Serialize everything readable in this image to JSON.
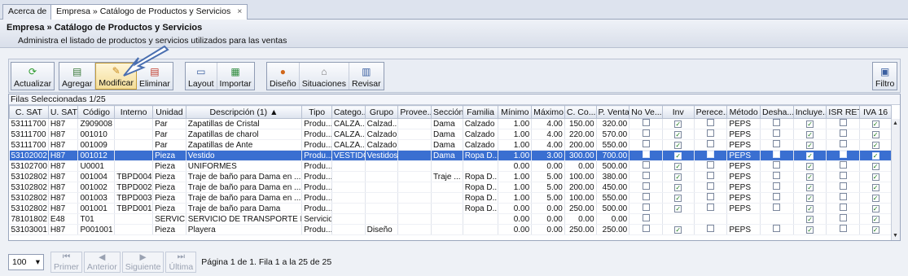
{
  "tabs": [
    {
      "label": "Acerca de"
    },
    {
      "label": "Empresa » Catálogo de Productos y Servicios",
      "close": "×"
    }
  ],
  "header": {
    "title": "Empresa » Catálogo de Productos y Servicios",
    "subtitle": "Administra el listado de productos y servicios utilizados para las ventas"
  },
  "toolbar": {
    "actualizar": "Actualizar",
    "agregar": "Agregar",
    "modificar": "Modificar",
    "eliminar": "Eliminar",
    "layout": "Layout",
    "importar": "Importar",
    "diseno": "Diseño",
    "situaciones": "Situaciones",
    "revisar": "Revisar",
    "filtro": "Filtro"
  },
  "grid": {
    "selection": "Filas Seleccionadas 1/25",
    "columns": [
      "C. SAT",
      "U. SAT",
      "Código",
      "Interno",
      "Unidad",
      "Descripción (1) ▲",
      "Tipo",
      "Catego...",
      "Grupo",
      "Provee...",
      "Sección",
      "Familia",
      "Mínimo",
      "Máximo",
      "C. Co...",
      "P. Venta",
      "No Ve...",
      "Inv",
      "Perece...",
      "Método",
      "Desha...",
      "Incluye...",
      "ISR RET",
      "IVA 16"
    ],
    "rows": [
      {
        "sat": "53111700",
        "usat": "H87",
        "codigo": "Z909008",
        "interno": "",
        "unidad": "Par",
        "desc": "Zapatillas de Cristal",
        "tipo": "Produ...",
        "cat": "CALZA...",
        "grupo": "Calzad...",
        "prov": "",
        "sec": "Dama",
        "fam": "Calzado",
        "min": "1.00",
        "max": "4.00",
        "cc": "150.00",
        "pv": "320.00",
        "nove": false,
        "inv": true,
        "pere": false,
        "met": "PEPS",
        "desha": false,
        "incl": true,
        "isr": false,
        "iva": true,
        "sel": false
      },
      {
        "sat": "53111700",
        "usat": "H87",
        "codigo": "001010",
        "interno": "",
        "unidad": "Par",
        "desc": "Zapatillas de charol",
        "tipo": "Produ...",
        "cat": "CALZA...",
        "grupo": "Calzado",
        "prov": "",
        "sec": "Dama",
        "fam": "Calzado",
        "min": "1.00",
        "max": "4.00",
        "cc": "220.00",
        "pv": "570.00",
        "nove": false,
        "inv": true,
        "pere": false,
        "met": "PEPS",
        "desha": false,
        "incl": true,
        "isr": false,
        "iva": true,
        "sel": false
      },
      {
        "sat": "53111700",
        "usat": "H87",
        "codigo": "001009",
        "interno": "",
        "unidad": "Par",
        "desc": "Zapatillas de Ante",
        "tipo": "Produ...",
        "cat": "CALZA...",
        "grupo": "Calzado",
        "prov": "",
        "sec": "Dama",
        "fam": "Calzado",
        "min": "1.00",
        "max": "4.00",
        "cc": "200.00",
        "pv": "550.00",
        "nove": false,
        "inv": true,
        "pere": false,
        "met": "PEPS",
        "desha": false,
        "incl": true,
        "isr": false,
        "iva": true,
        "sel": false
      },
      {
        "sat": "53102002",
        "usat": "H87",
        "codigo": "001012",
        "interno": "",
        "unidad": "Pieza",
        "desc": "Vestido",
        "tipo": "Produ...",
        "cat": "VESTIDO",
        "grupo": "Vestidos",
        "prov": "",
        "sec": "Dama",
        "fam": "Ropa D...",
        "min": "1.00",
        "max": "3.00",
        "cc": "300.00",
        "pv": "700.00",
        "nove": false,
        "inv": true,
        "pere": false,
        "met": "PEPS",
        "desha": false,
        "incl": true,
        "isr": false,
        "iva": true,
        "sel": true
      },
      {
        "sat": "53102700",
        "usat": "H87",
        "codigo": "U0001",
        "interno": "",
        "unidad": "Pieza",
        "desc": "UNIFORMES",
        "tipo": "Produ...",
        "cat": "",
        "grupo": "",
        "prov": "",
        "sec": "",
        "fam": "",
        "min": "0.00",
        "max": "0.00",
        "cc": "0.00",
        "pv": "500.00",
        "nove": false,
        "inv": true,
        "pere": false,
        "met": "PEPS",
        "desha": false,
        "incl": true,
        "isr": false,
        "iva": true,
        "sel": false
      },
      {
        "sat": "53102802",
        "usat": "H87",
        "codigo": "001004",
        "interno": "TBPD004",
        "unidad": "Pieza",
        "desc": "Traje de baño para Dama en ...",
        "tipo": "Produ...",
        "cat": "",
        "grupo": "",
        "prov": "",
        "sec": "Traje ...",
        "fam": "Ropa D...",
        "min": "1.00",
        "max": "5.00",
        "cc": "100.00",
        "pv": "380.00",
        "nove": false,
        "inv": true,
        "pere": false,
        "met": "PEPS",
        "desha": false,
        "incl": true,
        "isr": false,
        "iva": true,
        "sel": false
      },
      {
        "sat": "53102802",
        "usat": "H87",
        "codigo": "001002",
        "interno": "TBPD002",
        "unidad": "Pieza",
        "desc": "Traje de baño para Dama en ...",
        "tipo": "Produ...",
        "cat": "",
        "grupo": "",
        "prov": "",
        "sec": "",
        "fam": "Ropa D...",
        "min": "1.00",
        "max": "5.00",
        "cc": "200.00",
        "pv": "450.00",
        "nove": false,
        "inv": true,
        "pere": false,
        "met": "PEPS",
        "desha": false,
        "incl": true,
        "isr": false,
        "iva": true,
        "sel": false
      },
      {
        "sat": "53102802",
        "usat": "H87",
        "codigo": "001003",
        "interno": "TBPD003",
        "unidad": "Pieza",
        "desc": "Traje de baño para Dama en ...",
        "tipo": "Produ...",
        "cat": "",
        "grupo": "",
        "prov": "",
        "sec": "",
        "fam": "Ropa D...",
        "min": "1.00",
        "max": "5.00",
        "cc": "100.00",
        "pv": "550.00",
        "nove": false,
        "inv": true,
        "pere": false,
        "met": "PEPS",
        "desha": false,
        "incl": true,
        "isr": false,
        "iva": true,
        "sel": false
      },
      {
        "sat": "53102802",
        "usat": "H87",
        "codigo": "001001",
        "interno": "TBPD001",
        "unidad": "Pieza",
        "desc": "Traje de baño para Dama",
        "tipo": "Produ...",
        "cat": "",
        "grupo": "",
        "prov": "",
        "sec": "",
        "fam": "Ropa D...",
        "min": "0.00",
        "max": "0.00",
        "cc": "250.00",
        "pv": "500.00",
        "nove": false,
        "inv": true,
        "pere": false,
        "met": "PEPS",
        "desha": false,
        "incl": true,
        "isr": false,
        "iva": true,
        "sel": false
      },
      {
        "sat": "78101802",
        "usat": "E48",
        "codigo": "T01",
        "interno": "",
        "unidad": "SERVICIO",
        "desc": "SERVICIO DE TRANSPORTE F...",
        "tipo": "Servicio",
        "cat": "",
        "grupo": "",
        "prov": "",
        "sec": "",
        "fam": "",
        "min": "0.00",
        "max": "0.00",
        "cc": "0.00",
        "pv": "0.00",
        "nove": false,
        "inv": null,
        "pere": null,
        "met": "",
        "desha": null,
        "incl": true,
        "isr": false,
        "iva": true,
        "sel": false
      },
      {
        "sat": "53103001",
        "usat": "H87",
        "codigo": "P001001",
        "interno": "",
        "unidad": "Pieza",
        "desc": "Playera",
        "tipo": "Produ...",
        "cat": "",
        "grupo": "Diseño",
        "prov": "",
        "sec": "",
        "fam": "",
        "min": "0.00",
        "max": "0.00",
        "cc": "250.00",
        "pv": "250.00",
        "nove": false,
        "inv": true,
        "pere": false,
        "met": "PEPS",
        "desha": false,
        "incl": true,
        "isr": false,
        "iva": true,
        "sel": false
      }
    ]
  },
  "pager": {
    "page_size": "100",
    "primer": "Primer",
    "anterior": "Anterior",
    "siguiente": "Siguiente",
    "ultima": "Última",
    "info": "Página 1 de 1. Fila 1 a la 25 de 25"
  }
}
